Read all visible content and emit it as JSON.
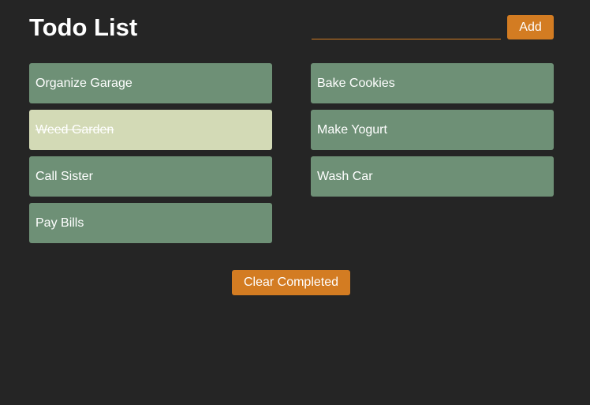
{
  "app": {
    "title": "Todo List"
  },
  "new_todo": {
    "value": "",
    "placeholder": "",
    "add_label": "Add"
  },
  "todos": {
    "left": [
      {
        "label": "Organize Garage",
        "completed": false
      },
      {
        "label": "Weed Garden",
        "completed": true
      },
      {
        "label": "Call Sister",
        "completed": false
      },
      {
        "label": "Pay Bills",
        "completed": false
      }
    ],
    "right": [
      {
        "label": "Bake Cookies",
        "completed": false
      },
      {
        "label": "Make Yogurt",
        "completed": false
      },
      {
        "label": "Wash Car",
        "completed": false
      }
    ]
  },
  "actions": {
    "clear_completed_label": "Clear Completed"
  },
  "colors": {
    "background": "#252525",
    "accent": "#d37c22",
    "todo_item": "#6e9076",
    "todo_item_completed": "#d3dab6",
    "text": "#ffffff"
  }
}
